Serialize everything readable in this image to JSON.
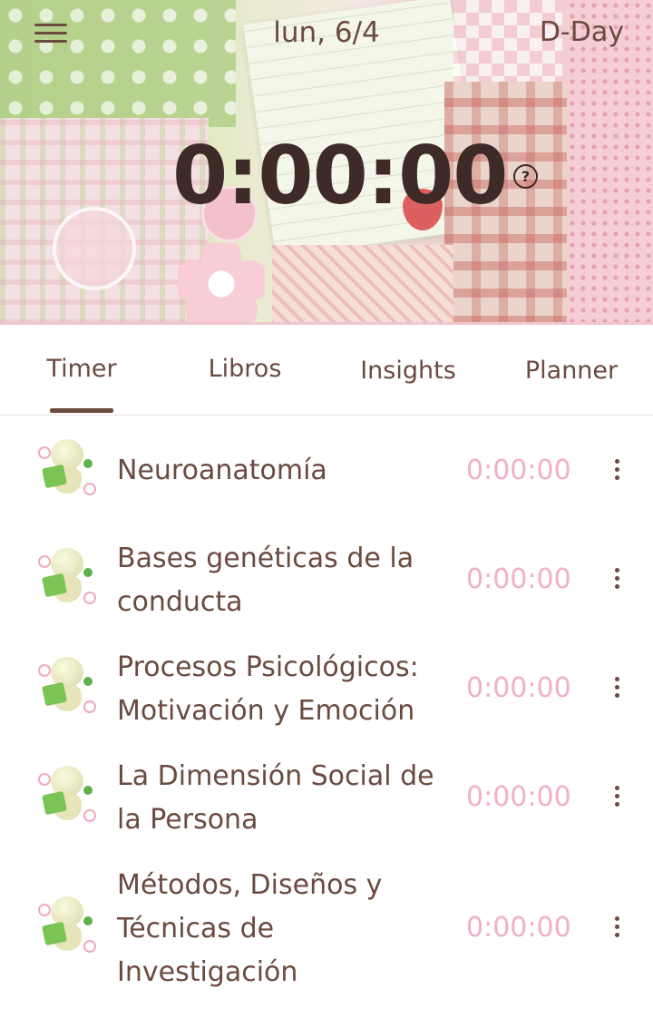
{
  "header": {
    "menu_icon": "hamburger-menu-icon",
    "date": "lun, 6/4",
    "dday_label": "D-Day",
    "total_timer": "0:00:00",
    "help_icon": "question-circle-icon",
    "help_glyph": "?"
  },
  "tabs": [
    {
      "label": "Timer",
      "active": true
    },
    {
      "label": "Libros",
      "active": false
    },
    {
      "label": "Insights",
      "active": false
    },
    {
      "label": "Planner",
      "active": false
    }
  ],
  "subjects": [
    {
      "name": "Neuroanatomía",
      "time": "0:00:00"
    },
    {
      "name": "Bases genéticas de la conducta",
      "time": "0:00:00"
    },
    {
      "name": "Procesos Psicológicos: Motivación y Emoción",
      "time": "0:00:00"
    },
    {
      "name": "La Dimensión Social de la Persona",
      "time": "0:00:00"
    },
    {
      "name": "Métodos, Diseños y Técnicas de Investigación",
      "time": "0:00:00"
    }
  ],
  "colors": {
    "text_brown": "#6b4a3f",
    "timer_dark": "#3e2a26",
    "subject_time_pink": "#f2afc6",
    "tab_underline": "#6b4a3f"
  }
}
